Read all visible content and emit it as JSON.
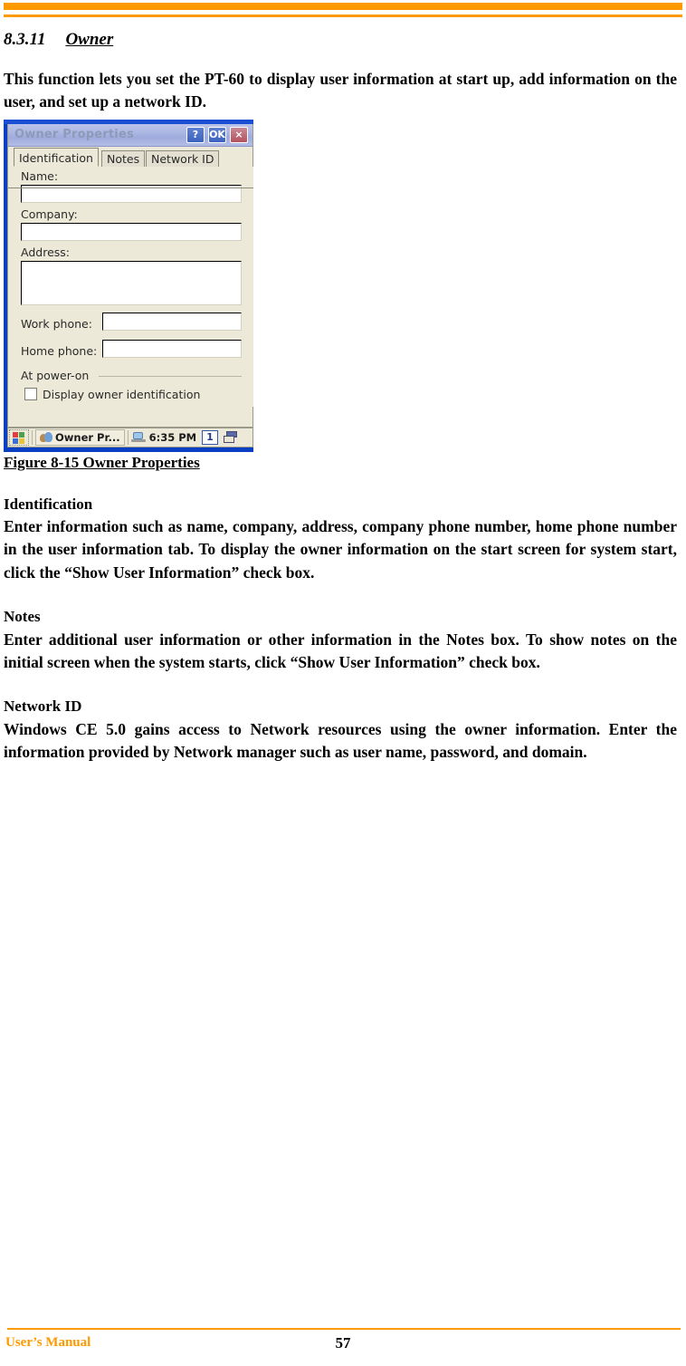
{
  "header": {
    "rule_color": "#FF9900"
  },
  "section": {
    "number": "8.3.11",
    "title": "Owner"
  },
  "intro_paragraph": "This function lets you set the PT-60 to display user information at start up, add information on the user, and set up a network ID.",
  "figure": {
    "caption": "Figure 8-15 Owner Properties"
  },
  "device_screenshot": {
    "dialog": {
      "title": "Owner Properties",
      "title_buttons": [
        {
          "name": "help-button",
          "label": "?"
        },
        {
          "name": "ok-button",
          "label": "OK"
        },
        {
          "name": "close-button",
          "label": "×"
        }
      ],
      "tabs": [
        {
          "label": "Identification",
          "active": true
        },
        {
          "label": "Notes",
          "active": false
        },
        {
          "label": "Network ID",
          "active": false
        }
      ],
      "fields": [
        {
          "label": "Name:",
          "value": ""
        },
        {
          "label": "Company:",
          "value": ""
        },
        {
          "label": "Address:",
          "value": ""
        },
        {
          "label": "Work phone:",
          "value": ""
        },
        {
          "label": "Home phone:",
          "value": ""
        }
      ],
      "group": {
        "label": "At power-on",
        "checkbox_label": "Display owner identification",
        "checked": false
      }
    },
    "taskbar": {
      "start_icon": "windows-flag-icon",
      "task_label": "Owner Pr...",
      "clock": "6:35 PM",
      "input_indicator": "1",
      "tray_icon": "stacked-windows-icon"
    },
    "desktop_color": "#0a3fc4"
  },
  "sections": [
    {
      "heading": "Identification",
      "text": "Enter information such as name, company, address, company phone number, home phone number in the user information tab. To display the owner information on the start screen for system start, click the “Show User Information” check box."
    },
    {
      "heading": "Notes",
      "text": "Enter additional user information or other information in the Notes box. To show notes on the initial screen when the system starts, click “Show User Information” check box."
    },
    {
      "heading": "Network ID",
      "text": "Windows CE 5.0 gains access to Network resources using the owner information. Enter the information provided by Network manager such as user name, password, and domain."
    }
  ],
  "footer": {
    "left_text": "User’s Manual",
    "page_number": "57"
  }
}
